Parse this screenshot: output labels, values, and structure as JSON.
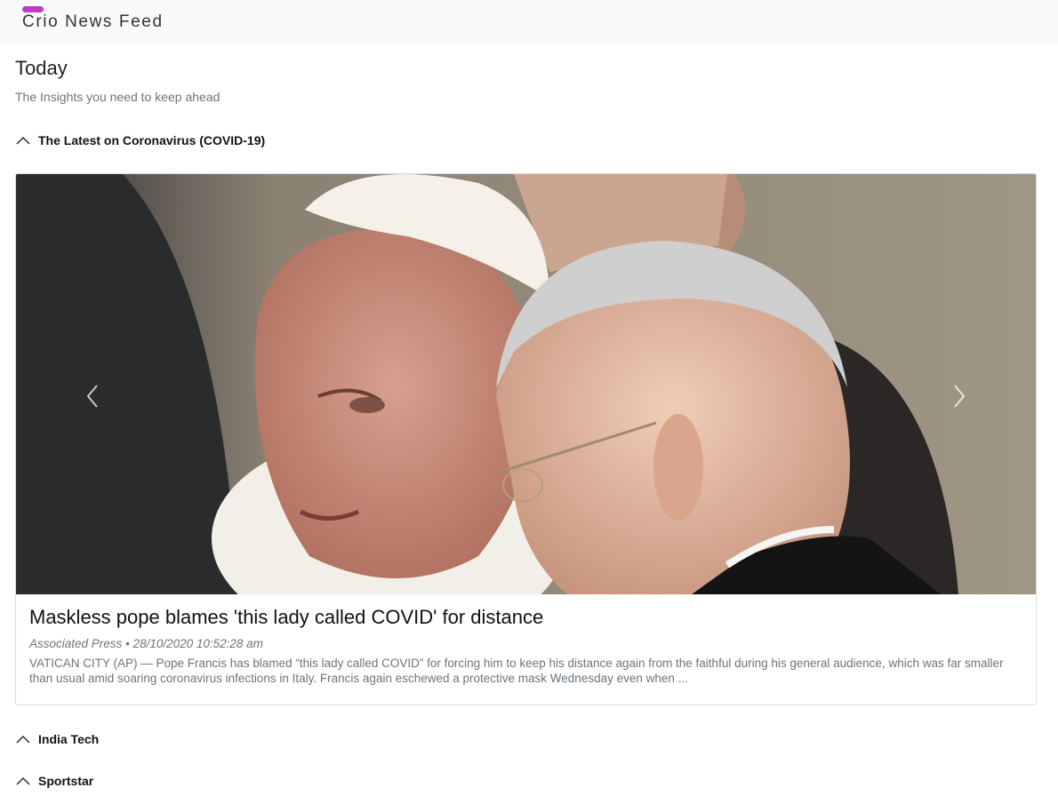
{
  "navbar": {
    "brand": "Crio News Feed"
  },
  "header": {
    "title": "Today",
    "subtitle": "The Insights you need to keep ahead"
  },
  "sections": [
    {
      "label": "The Latest on Coronavirus (COVID-19)",
      "expanded": true
    },
    {
      "label": "India Tech",
      "expanded": false
    },
    {
      "label": "Sportstar",
      "expanded": false
    }
  ],
  "article": {
    "title": "Maskless pope blames 'this lady called COVID' for distance",
    "source": "Associated Press",
    "date": "28/10/2020 10:52:28 am",
    "separator": "•",
    "description": "VATICAN CITY (AP) — Pope Francis has blamed “this lady called COVID” for forcing him to keep his distance again from the faithful during his general audience, which was far smaller than usual amid soaring coronavirus infections in Italy. Francis again eschewed a protective mask Wednesday even when ..."
  },
  "icons": {
    "section_toggle": "chevron-up-icon",
    "carousel_prev": "chevron-left-icon",
    "carousel_next": "chevron-right-icon"
  },
  "colors": {
    "brand_accent": "#c23ac4",
    "navbar_bg": "#f8f9fa",
    "muted_text": "#6c757d"
  }
}
